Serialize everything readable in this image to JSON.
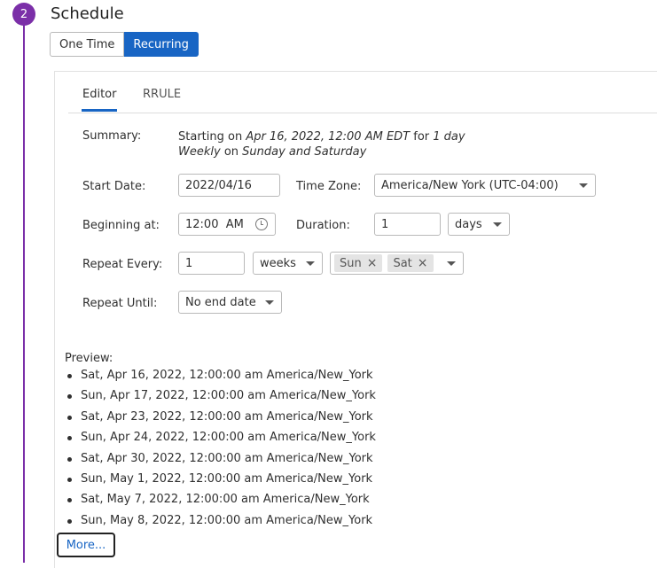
{
  "step": {
    "number": "2",
    "title": "Schedule"
  },
  "mode": {
    "one_time": "One Time",
    "recurring": "Recurring",
    "selected": "Recurring"
  },
  "tabs": {
    "editor": "Editor",
    "rrule": "RRULE",
    "active": "Editor"
  },
  "summary": {
    "label": "Summary:",
    "line1_prefix": "Starting on ",
    "start_text": "Apr 16, 2022, 12:00 AM EDT",
    "line1_mid": " for ",
    "duration_text": "1 day",
    "frequency_text": "Weekly",
    "line2_mid": " on ",
    "days_text": "Sunday and Saturday"
  },
  "form": {
    "start_date": {
      "label": "Start Date:",
      "value": "2022/04/16"
    },
    "time_zone": {
      "label": "Time Zone:",
      "value": "America/New York (UTC-04:00)"
    },
    "beginning_at": {
      "label": "Beginning at:",
      "value": "12:00  AM"
    },
    "duration": {
      "label": "Duration:",
      "value": "1",
      "unit": "days"
    },
    "repeat_every": {
      "label": "Repeat Every:",
      "value": "1",
      "unit": "weeks",
      "days": [
        "Sun",
        "Sat"
      ]
    },
    "repeat_until": {
      "label": "Repeat Until:",
      "value": "No end date"
    }
  },
  "preview": {
    "label": "Preview:",
    "items": [
      "Sat, Apr 16, 2022, 12:00:00 am America/New_York",
      "Sun, Apr 17, 2022, 12:00:00 am America/New_York",
      "Sat, Apr 23, 2022, 12:00:00 am America/New_York",
      "Sun, Apr 24, 2022, 12:00:00 am America/New_York",
      "Sat, Apr 30, 2022, 12:00:00 am America/New_York",
      "Sun, May 1, 2022, 12:00:00 am America/New_York",
      "Sat, May 7, 2022, 12:00:00 am America/New_York",
      "Sun, May 8, 2022, 12:00:00 am America/New_York"
    ],
    "more": "More..."
  },
  "colors": {
    "accent": "#1865c4",
    "step": "#7b2fa8"
  }
}
